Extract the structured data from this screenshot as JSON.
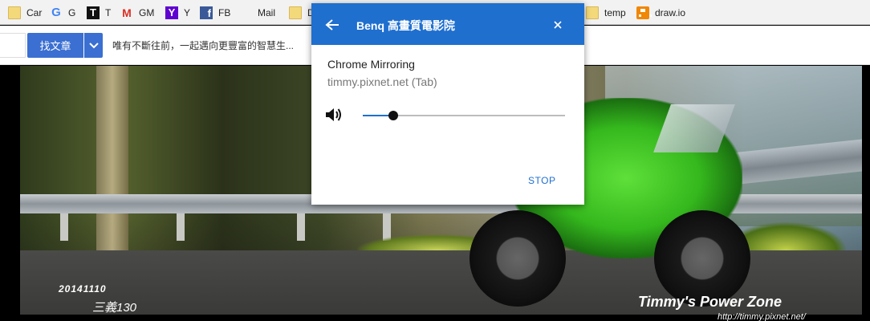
{
  "bookmarks": [
    {
      "label": "Car",
      "icon": "folder-icon"
    },
    {
      "label": "G",
      "icon": "google-icon"
    },
    {
      "label": "T",
      "icon": "t-icon"
    },
    {
      "label": "GM",
      "icon": "gmail-icon"
    },
    {
      "label": "Y",
      "icon": "yahoo-icon"
    },
    {
      "label": "FB",
      "icon": "facebook-icon"
    },
    {
      "label": "Mail",
      "icon": "microsoft-icon"
    },
    {
      "label": "D",
      "icon": "folder-icon"
    },
    {
      "label": "temp",
      "icon": "folder-icon"
    },
    {
      "label": "draw.io",
      "icon": "drawio-icon"
    }
  ],
  "search": {
    "button_label": "找文章",
    "tagline": "唯有不斷往前，一起邁向更豐富的智慧生..."
  },
  "photo": {
    "date": "20141110",
    "place": "三義130",
    "brand": "Timmy's Power Zone",
    "url": "http://timmy.pixnet.net/"
  },
  "cast": {
    "device_name": "Benq 高畫質電影院",
    "app_name": "Chrome Mirroring",
    "source": "timmy.pixnet.net (Tab)",
    "volume_fraction": 0.15,
    "stop_label": "STOP",
    "accent_color": "#1f6fcf"
  }
}
